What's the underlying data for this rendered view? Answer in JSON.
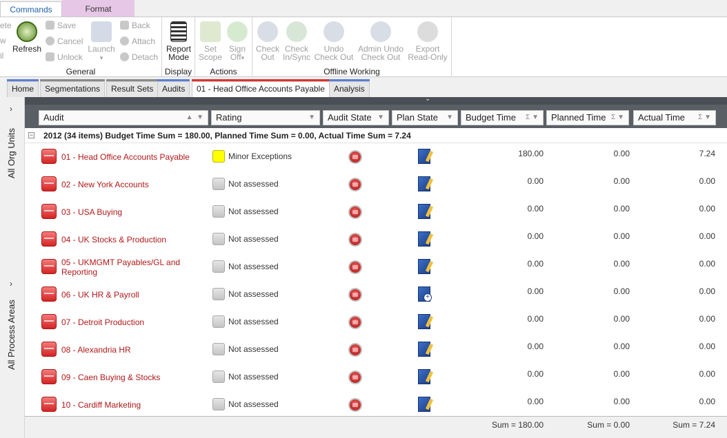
{
  "ribbon": {
    "tabs": [
      "Commands",
      "Format"
    ],
    "groups": {
      "general": {
        "label": "General",
        "refresh": "Refresh",
        "save": "Save",
        "cancel": "Cancel",
        "unlock": "Unlock",
        "launch": "Launch",
        "back": "Back",
        "attach": "Attach",
        "detach": "Detach",
        "cut_left_1": "ete",
        "cut_left_2": "w",
        "cut_left_3": "il"
      },
      "display": {
        "label": "Display",
        "report_mode_1": "Report",
        "report_mode_2": "Mode"
      },
      "actions": {
        "label": "Actions",
        "set_scope_1": "Set",
        "set_scope_2": "Scope",
        "sign_off_1": "Sign",
        "sign_off_2": "Off"
      },
      "offline": {
        "label": "Offline Working",
        "check_out_1": "Check",
        "check_out_2": "Out",
        "check_in_1": "Check",
        "check_in_2": "In/Sync",
        "undo_1": "Undo",
        "undo_2": "Check Out",
        "admin_undo_1": "Admin Undo",
        "admin_undo_2": "Check Out",
        "export_1": "Export",
        "export_2": "Read-Only"
      }
    }
  },
  "doc_tabs": [
    "Home",
    "Segmentations",
    "Result Sets",
    "Audits",
    "01 - Head Office Accounts Payable",
    "Analysis"
  ],
  "side_labels": [
    "All Org Units",
    "All Process Areas"
  ],
  "columns": [
    "Audit",
    "Rating",
    "Audit State",
    "Plan State",
    "Budget Time",
    "Planned Time",
    "Actual Time"
  ],
  "group_row": "2012 (34 items) Budget Time Sum = 180.00, Planned Time Sum = 0.00, Actual Time Sum = 7.24",
  "rows": [
    {
      "name": "01 - Head Office Accounts Payable",
      "rating": "Minor Exceptions",
      "rating_color": "#ffff00",
      "budget": "180.00",
      "planned": "0.00",
      "actual": "7.24"
    },
    {
      "name": "02 - New York Accounts",
      "rating": "Not assessed",
      "budget": "0.00",
      "planned": "0.00",
      "actual": "0.00"
    },
    {
      "name": "03 - USA Buying",
      "rating": "Not assessed",
      "budget": "0.00",
      "planned": "0.00",
      "actual": "0.00"
    },
    {
      "name": "04 - UK Stocks & Production",
      "rating": "Not assessed",
      "budget": "0.00",
      "planned": "0.00",
      "actual": "0.00"
    },
    {
      "name": "05 - UKMGMT Payables/GL and Reporting",
      "rating": "Not assessed",
      "budget": "0.00",
      "planned": "0.00",
      "actual": "0.00"
    },
    {
      "name": "06 - UK HR & Payroll",
      "rating": "Not assessed",
      "budget": "0.00",
      "planned": "0.00",
      "actual": "0.00"
    },
    {
      "name": "07 - Detroit Production",
      "rating": "Not assessed",
      "budget": "0.00",
      "planned": "0.00",
      "actual": "0.00"
    },
    {
      "name": "08 - Alexandria HR",
      "rating": "Not assessed",
      "budget": "0.00",
      "planned": "0.00",
      "actual": "0.00"
    },
    {
      "name": "09 - Caen Buying & Stocks",
      "rating": "Not assessed",
      "budget": "0.00",
      "planned": "0.00",
      "actual": "0.00"
    },
    {
      "name": "10 - Cardiff Marketing",
      "rating": "Not assessed",
      "budget": "0.00",
      "planned": "0.00",
      "actual": "0.00"
    }
  ],
  "sums": {
    "budget": "Sum = 180.00",
    "planned": "Sum = 0.00",
    "actual": "Sum = 7.24"
  }
}
